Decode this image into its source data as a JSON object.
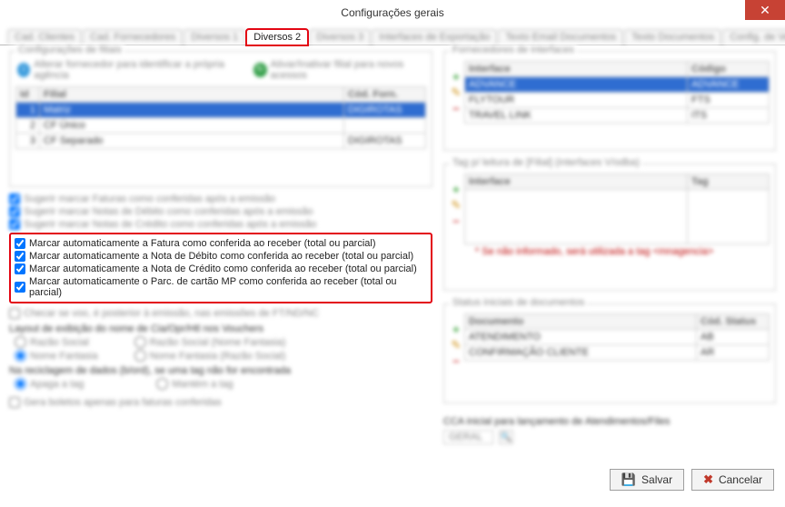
{
  "window": {
    "title": "Configurações gerais"
  },
  "tabs": {
    "items": [
      "Cad. Clientes",
      "Cad. Fornecedores",
      "Diversos 1",
      "Diversos 2",
      "Diversos 3",
      "Interfaces de Exportação",
      "Texto Email Documentos",
      "Texto Documentos",
      "Config. de Vendas"
    ],
    "activeIndex": 3,
    "arrowLeft": "◄",
    "arrowRight": "►"
  },
  "filiais": {
    "title": "Configurações de filiais",
    "link1": "Alterar fornecedor para identificar a própria agência",
    "link2": "Ativar/Inativar filial para novos acessos",
    "headers": [
      "Id",
      "Filial",
      "Cód. Forn."
    ],
    "rows": [
      {
        "id": "1",
        "filial": "Matriz",
        "cod": "DIGIROTAS"
      },
      {
        "id": "2",
        "filial": "CF Único",
        "cod": ""
      },
      {
        "id": "3",
        "filial": "CF Separado",
        "cod": "DIGIROTAS"
      }
    ]
  },
  "checks_top": [
    "Sugerir marcar Faturas como conferidas após a emissão",
    "Sugerir marcar Notas de Débito como conferidas após a emissão",
    "Sugerir marcar Notas de Crédito como conferidas após a emissão"
  ],
  "checks_red": [
    "Marcar automaticamente a Fatura como conferida ao receber (total ou parcial)",
    "Marcar automaticamente a Nota de Débito como conferida ao receber (total ou parcial)",
    "Marcar automaticamente a Nota de Crédito como conferida ao receber (total ou parcial)",
    "Marcar automaticamente o Parc. de cartão MP como conferida ao receber (total ou parcial)"
  ],
  "check_after_red": "Checar se voo, é posterior à emissão, nas emissões de FT/ND/NC",
  "layout": {
    "title": "Layout de exibição do nome de Cia/Opr/Htl nos Vouchers",
    "options": [
      [
        "Razão Social",
        "Razão Social (Nome Fantasia)"
      ],
      [
        "Nome Fantasia",
        "Nome Fantasia (Razão Social)"
      ]
    ]
  },
  "reciclagem": {
    "title": "Na reciclagem de dados (b/ord), se uma tag não for encontrada",
    "opt1": "Apaga a tag",
    "opt2": "Mantém a tag"
  },
  "boletos": "Gera boletos apenas para faturas conferidas",
  "fornecedores_if": {
    "title": "Fornecedores de interfaces",
    "headers": [
      "Interface",
      "Código"
    ],
    "rows": [
      {
        "iface": "ADVANCE",
        "cod": "ADVANCE",
        "selected": true
      },
      {
        "iface": "FLYTOUR",
        "cod": "FTS"
      },
      {
        "iface": "TRAVEL LINK",
        "cod": "ITS"
      }
    ]
  },
  "tags_filial": {
    "title": "Tag p/ leitura de [Filial] (interfaces V/odba)",
    "headers": [
      "Interface",
      "Tag"
    ],
    "note": "* Se não informado, será utilizada a tag <mnagencia>"
  },
  "status_docs": {
    "title": "Status iniciais de documentos",
    "headers": [
      "Documento",
      "Cód. Status"
    ],
    "rows": [
      {
        "doc": "ATENDIMENTO",
        "cod": "AB"
      },
      {
        "doc": "CONFIRMAÇÃO CLIENTE",
        "cod": "AR"
      }
    ]
  },
  "cca": {
    "label": "CCA inicial para lançamento de Atendimentos/Files",
    "value": "GERAL"
  },
  "footer": {
    "save": "Salvar",
    "cancel": "Cancelar"
  }
}
